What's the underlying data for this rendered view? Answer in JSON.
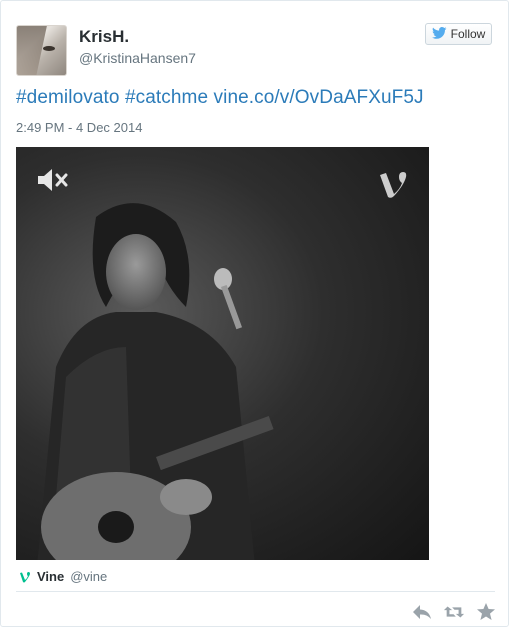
{
  "user": {
    "name": "KrisH.",
    "handle": "@KristinaHansen7"
  },
  "follow_button": {
    "label": "Follow",
    "icon": "twitter-bird-icon"
  },
  "tweet": {
    "hashtag1": "#demilovato",
    "hashtag2": "#catchme",
    "link": "vine.co/v/OvDaAFXuF5J",
    "timestamp": "2:49 PM - 4 Dec 2014"
  },
  "media": {
    "mute_icon": "speaker-muted-icon",
    "logo_icon": "vine-logo-icon"
  },
  "card_footer": {
    "brand": "Vine",
    "handle": "@vine",
    "icon": "vine-logo-icon"
  },
  "actions": {
    "reply_icon": "reply-icon",
    "retweet_icon": "retweet-icon",
    "favorite_icon": "star-icon"
  },
  "colors": {
    "link": "#2b7bb9",
    "twitter_blue": "#55acee",
    "vine_green": "#00bf8f",
    "text_dark": "#292f33",
    "text_muted": "#66757f"
  }
}
